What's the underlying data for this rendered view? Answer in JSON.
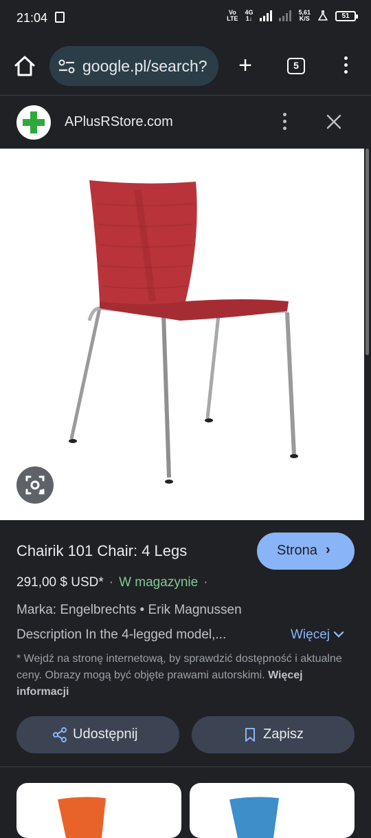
{
  "status_bar": {
    "time": "21:04",
    "network_top": "Vo",
    "network_bottom": "LTE",
    "gen_top": "4G",
    "gen_bottom": "1↓",
    "speed_top": "5,61",
    "speed_bottom": "K/S",
    "battery": "51"
  },
  "toolbar": {
    "url": "google.pl/search?",
    "tab_count": "5"
  },
  "panel": {
    "site_name": "APlusRStore.com"
  },
  "product": {
    "title": "Chairik 101 Chair: 4 Legs",
    "visit_button": "Strona",
    "price": "291,00 $ USD*",
    "stock": "W magazynie",
    "brand": "Marka: Engelbrechts • Erik Magnussen",
    "description": "Description In the 4-legged model,...",
    "more_label": "Więcej",
    "disclaimer_text": "* Wejdź na stronę internetową, by sprawdzić dostępność i aktualne ceny. Obrazy mogą być objęte prawami autorskimi. ",
    "disclaimer_link": "Więcej informacji",
    "share_label": "Udostępnij",
    "save_label": "Zapisz"
  },
  "colors": {
    "accent": "#8ab4f8",
    "stock_green": "#81c995",
    "chair_red": "#b8343a",
    "card2_chair": "#3d8ec9",
    "card1_chair": "#e8632a"
  }
}
